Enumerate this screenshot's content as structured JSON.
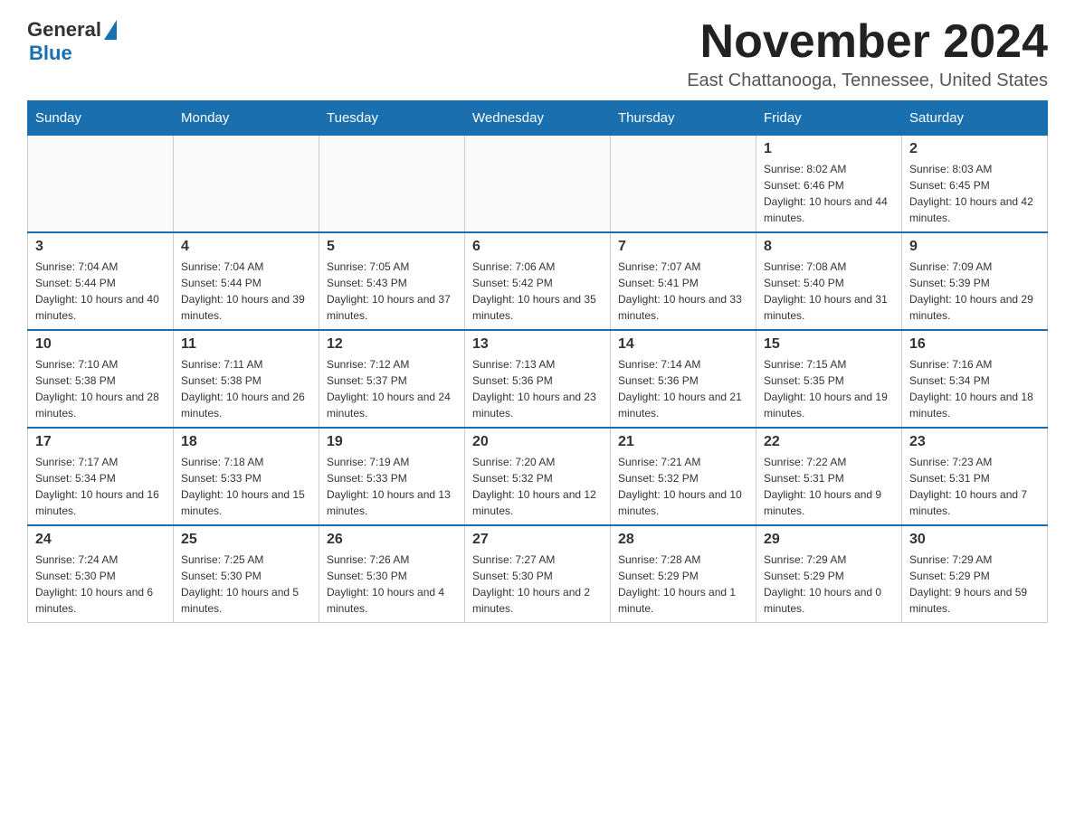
{
  "logo": {
    "general": "General",
    "blue": "Blue"
  },
  "title": "November 2024",
  "location": "East Chattanooga, Tennessee, United States",
  "weekdays": [
    "Sunday",
    "Monday",
    "Tuesday",
    "Wednesday",
    "Thursday",
    "Friday",
    "Saturday"
  ],
  "weeks": [
    [
      {
        "day": "",
        "sunrise": "",
        "sunset": "",
        "daylight": ""
      },
      {
        "day": "",
        "sunrise": "",
        "sunset": "",
        "daylight": ""
      },
      {
        "day": "",
        "sunrise": "",
        "sunset": "",
        "daylight": ""
      },
      {
        "day": "",
        "sunrise": "",
        "sunset": "",
        "daylight": ""
      },
      {
        "day": "",
        "sunrise": "",
        "sunset": "",
        "daylight": ""
      },
      {
        "day": "1",
        "sunrise": "Sunrise: 8:02 AM",
        "sunset": "Sunset: 6:46 PM",
        "daylight": "Daylight: 10 hours and 44 minutes."
      },
      {
        "day": "2",
        "sunrise": "Sunrise: 8:03 AM",
        "sunset": "Sunset: 6:45 PM",
        "daylight": "Daylight: 10 hours and 42 minutes."
      }
    ],
    [
      {
        "day": "3",
        "sunrise": "Sunrise: 7:04 AM",
        "sunset": "Sunset: 5:44 PM",
        "daylight": "Daylight: 10 hours and 40 minutes."
      },
      {
        "day": "4",
        "sunrise": "Sunrise: 7:04 AM",
        "sunset": "Sunset: 5:44 PM",
        "daylight": "Daylight: 10 hours and 39 minutes."
      },
      {
        "day": "5",
        "sunrise": "Sunrise: 7:05 AM",
        "sunset": "Sunset: 5:43 PM",
        "daylight": "Daylight: 10 hours and 37 minutes."
      },
      {
        "day": "6",
        "sunrise": "Sunrise: 7:06 AM",
        "sunset": "Sunset: 5:42 PM",
        "daylight": "Daylight: 10 hours and 35 minutes."
      },
      {
        "day": "7",
        "sunrise": "Sunrise: 7:07 AM",
        "sunset": "Sunset: 5:41 PM",
        "daylight": "Daylight: 10 hours and 33 minutes."
      },
      {
        "day": "8",
        "sunrise": "Sunrise: 7:08 AM",
        "sunset": "Sunset: 5:40 PM",
        "daylight": "Daylight: 10 hours and 31 minutes."
      },
      {
        "day": "9",
        "sunrise": "Sunrise: 7:09 AM",
        "sunset": "Sunset: 5:39 PM",
        "daylight": "Daylight: 10 hours and 29 minutes."
      }
    ],
    [
      {
        "day": "10",
        "sunrise": "Sunrise: 7:10 AM",
        "sunset": "Sunset: 5:38 PM",
        "daylight": "Daylight: 10 hours and 28 minutes."
      },
      {
        "day": "11",
        "sunrise": "Sunrise: 7:11 AM",
        "sunset": "Sunset: 5:38 PM",
        "daylight": "Daylight: 10 hours and 26 minutes."
      },
      {
        "day": "12",
        "sunrise": "Sunrise: 7:12 AM",
        "sunset": "Sunset: 5:37 PM",
        "daylight": "Daylight: 10 hours and 24 minutes."
      },
      {
        "day": "13",
        "sunrise": "Sunrise: 7:13 AM",
        "sunset": "Sunset: 5:36 PM",
        "daylight": "Daylight: 10 hours and 23 minutes."
      },
      {
        "day": "14",
        "sunrise": "Sunrise: 7:14 AM",
        "sunset": "Sunset: 5:36 PM",
        "daylight": "Daylight: 10 hours and 21 minutes."
      },
      {
        "day": "15",
        "sunrise": "Sunrise: 7:15 AM",
        "sunset": "Sunset: 5:35 PM",
        "daylight": "Daylight: 10 hours and 19 minutes."
      },
      {
        "day": "16",
        "sunrise": "Sunrise: 7:16 AM",
        "sunset": "Sunset: 5:34 PM",
        "daylight": "Daylight: 10 hours and 18 minutes."
      }
    ],
    [
      {
        "day": "17",
        "sunrise": "Sunrise: 7:17 AM",
        "sunset": "Sunset: 5:34 PM",
        "daylight": "Daylight: 10 hours and 16 minutes."
      },
      {
        "day": "18",
        "sunrise": "Sunrise: 7:18 AM",
        "sunset": "Sunset: 5:33 PM",
        "daylight": "Daylight: 10 hours and 15 minutes."
      },
      {
        "day": "19",
        "sunrise": "Sunrise: 7:19 AM",
        "sunset": "Sunset: 5:33 PM",
        "daylight": "Daylight: 10 hours and 13 minutes."
      },
      {
        "day": "20",
        "sunrise": "Sunrise: 7:20 AM",
        "sunset": "Sunset: 5:32 PM",
        "daylight": "Daylight: 10 hours and 12 minutes."
      },
      {
        "day": "21",
        "sunrise": "Sunrise: 7:21 AM",
        "sunset": "Sunset: 5:32 PM",
        "daylight": "Daylight: 10 hours and 10 minutes."
      },
      {
        "day": "22",
        "sunrise": "Sunrise: 7:22 AM",
        "sunset": "Sunset: 5:31 PM",
        "daylight": "Daylight: 10 hours and 9 minutes."
      },
      {
        "day": "23",
        "sunrise": "Sunrise: 7:23 AM",
        "sunset": "Sunset: 5:31 PM",
        "daylight": "Daylight: 10 hours and 7 minutes."
      }
    ],
    [
      {
        "day": "24",
        "sunrise": "Sunrise: 7:24 AM",
        "sunset": "Sunset: 5:30 PM",
        "daylight": "Daylight: 10 hours and 6 minutes."
      },
      {
        "day": "25",
        "sunrise": "Sunrise: 7:25 AM",
        "sunset": "Sunset: 5:30 PM",
        "daylight": "Daylight: 10 hours and 5 minutes."
      },
      {
        "day": "26",
        "sunrise": "Sunrise: 7:26 AM",
        "sunset": "Sunset: 5:30 PM",
        "daylight": "Daylight: 10 hours and 4 minutes."
      },
      {
        "day": "27",
        "sunrise": "Sunrise: 7:27 AM",
        "sunset": "Sunset: 5:30 PM",
        "daylight": "Daylight: 10 hours and 2 minutes."
      },
      {
        "day": "28",
        "sunrise": "Sunrise: 7:28 AM",
        "sunset": "Sunset: 5:29 PM",
        "daylight": "Daylight: 10 hours and 1 minute."
      },
      {
        "day": "29",
        "sunrise": "Sunrise: 7:29 AM",
        "sunset": "Sunset: 5:29 PM",
        "daylight": "Daylight: 10 hours and 0 minutes."
      },
      {
        "day": "30",
        "sunrise": "Sunrise: 7:29 AM",
        "sunset": "Sunset: 5:29 PM",
        "daylight": "Daylight: 9 hours and 59 minutes."
      }
    ]
  ]
}
